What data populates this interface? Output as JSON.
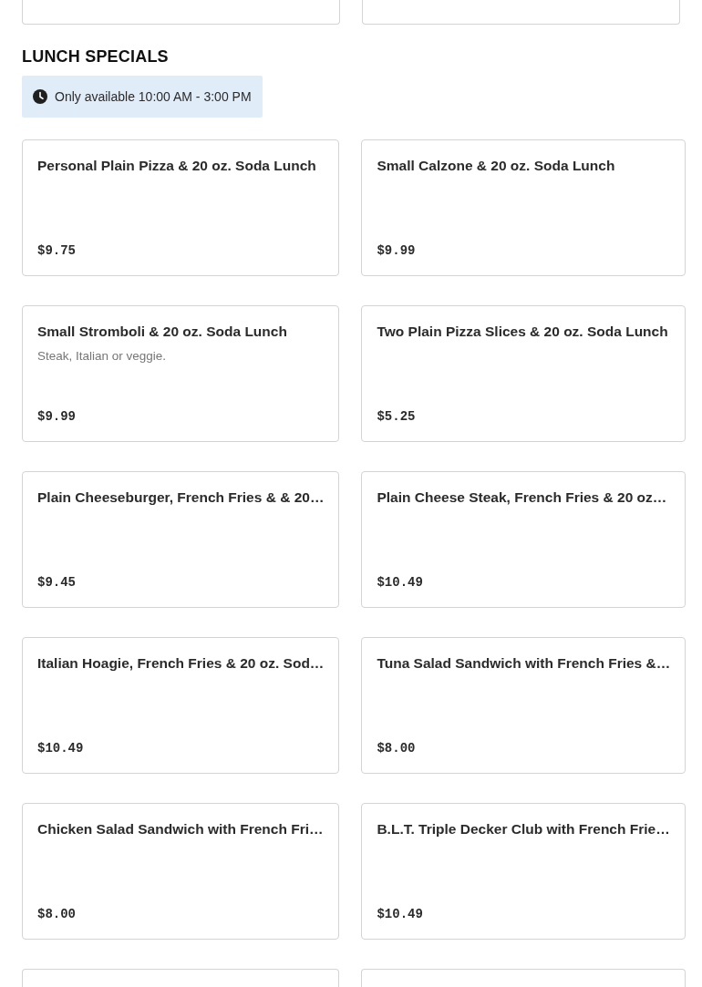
{
  "previous_section": {
    "items": [
      {
        "kind": "cut"
      },
      {
        "kind": "cut"
      }
    ]
  },
  "lunch_specials": {
    "title": "LUNCH SPECIALS",
    "notice": "Only available 10:00 AM - 3:00 PM",
    "items": [
      {
        "kind": "full",
        "name": "Personal Plain Pizza & 20 oz. Soda Lunch",
        "price": "$9.75"
      },
      {
        "kind": "full",
        "name": "Small Calzone & 20 oz. Soda Lunch",
        "price": "$9.99"
      },
      {
        "kind": "full",
        "name": "Small Stromboli & 20 oz. Soda Lunch",
        "description": "Steak, Italian or veggie.",
        "price": "$9.99"
      },
      {
        "kind": "full",
        "name": "Two Plain Pizza Slices & 20 oz. Soda Lunch",
        "price": "$5.25"
      },
      {
        "kind": "full",
        "name": "Plain Cheeseburger, French Fries & & 20…",
        "price": "$9.45"
      },
      {
        "kind": "full",
        "name": "Plain Cheese Steak, French Fries & 20 oz…",
        "price": "$10.49"
      },
      {
        "kind": "full",
        "name": "Italian Hoagie, French Fries & 20 oz. Sod…",
        "price": "$10.49"
      },
      {
        "kind": "full",
        "name": "Tuna Salad Sandwich with French Fries &…",
        "price": "$8.00"
      },
      {
        "kind": "full",
        "name": "Chicken Salad Sandwich with French Fri…",
        "price": "$8.00"
      },
      {
        "kind": "full",
        "name": "B.L.T. Triple Decker Club with French Frie…",
        "price": "$10.49"
      },
      {
        "kind": "cut"
      },
      {
        "kind": "cut"
      }
    ]
  }
}
